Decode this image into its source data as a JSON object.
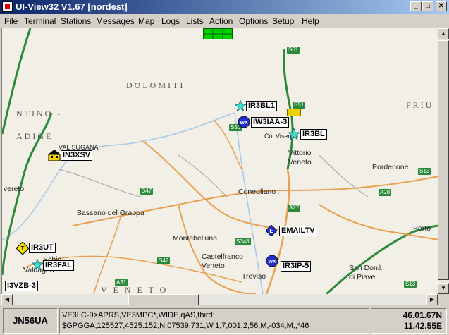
{
  "window": {
    "title": "UI-View32 V1.67 [nordest]",
    "minimize": "_",
    "maximize": "□",
    "close": "✕"
  },
  "menu": [
    "File",
    "Terminal",
    "Stations",
    "Messages",
    "Map",
    "Logs",
    "Lists",
    "Action",
    "Options",
    "Setup",
    "Help"
  ],
  "map": {
    "regions": [
      "DOLOMITI",
      "NTINO -",
      "ADIGE",
      "FRIU",
      "VAL SUGANA",
      "V E N E T O"
    ],
    "places": [
      "Col Visentin",
      "Vittorio",
      "Veneto",
      "Pordenone",
      "Conegliano",
      "Bassano del Grappa",
      "Montebelluna",
      "Castelfranco",
      "Veneto",
      "Treviso",
      "San Donà",
      "di Piave",
      "Porto",
      "Schio",
      "vereto",
      "Valdagno"
    ],
    "roads": [
      "S51",
      "S51",
      "S50",
      "S13",
      "S47",
      "A28",
      "A27",
      "S348",
      "S47",
      "A31",
      "S13"
    ],
    "stations": [
      {
        "call": "IR3BL1",
        "icon": "star-icon"
      },
      {
        "call": "IW3IAA-3",
        "icon": "wx-icon"
      },
      {
        "call": "IR3BL",
        "icon": "star-icon"
      },
      {
        "call": "IN3XSV",
        "icon": "house-icon"
      },
      {
        "call": "EMAILTV",
        "icon": "diamond-icon"
      },
      {
        "call": "IR3UT",
        "icon": "yield-icon"
      },
      {
        "call": "IR3FAL",
        "icon": "star-icon"
      },
      {
        "call": "I3VZB-3",
        "icon": "none"
      },
      {
        "call": "IR3IP-5",
        "icon": "wx-icon"
      }
    ]
  },
  "status": {
    "locator": "JN56UA",
    "packet_line1": "VE3LC-9>APRS,VE3MPC*,WIDE,qAS,third:",
    "packet_line2": "$GPGGA,125527,4525.152,N,07539.731,W,1,7,001.2,56,M,-034,M,,*46",
    "lat": "46.01.67N",
    "lon": "11.42.55E"
  },
  "colors": {
    "title_start": "#0a246a",
    "title_end": "#a6caf0",
    "grid_indicator": "#00d000",
    "road_green": "#2a8a3a",
    "road_orange": "#e8a050"
  }
}
